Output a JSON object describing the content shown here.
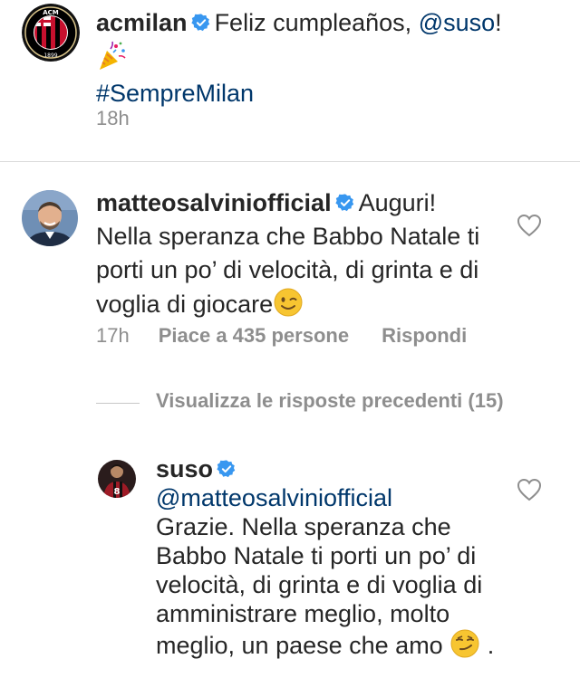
{
  "caption": {
    "username": "acmilan",
    "verified": true,
    "text": "Feliz cumpleaños,",
    "mention": "@suso",
    "text_after": "!",
    "emoji": "party-popper-emoji",
    "hashtag": "#SempreMilan",
    "time": "18h",
    "avatar_logo": {
      "top": "ACM",
      "bottom": "1899"
    }
  },
  "comment": {
    "username": "matteosalviniofficial",
    "verified": true,
    "text": "Auguri! Nella speranza che Babbo Natale ti porti un po’ di velocità, di grinta e di voglia di giocare",
    "emoji": "winking-face-emoji",
    "time": "17h",
    "likes": "Piace a 435 persone",
    "reply": "Rispondi"
  },
  "view_replies": {
    "label": "Visualizza le risposte precedenti (15)"
  },
  "reply": {
    "username": "suso",
    "verified": true,
    "mention": "@matteosalviniofficial",
    "text": "Grazie. Nella speranza che Babbo Natale ti porti un po’ di velocità, di grinta e di voglia di amministrare meglio, molto meglio, un paese che amo",
    "emoji": "smirking-face-emoji",
    "text_after": "."
  },
  "colors": {
    "link": "#00376b",
    "verified": "#3897f0",
    "secondary_text": "#8e8e8e",
    "primary_text": "#262626",
    "milan_red": "#c8102e"
  }
}
